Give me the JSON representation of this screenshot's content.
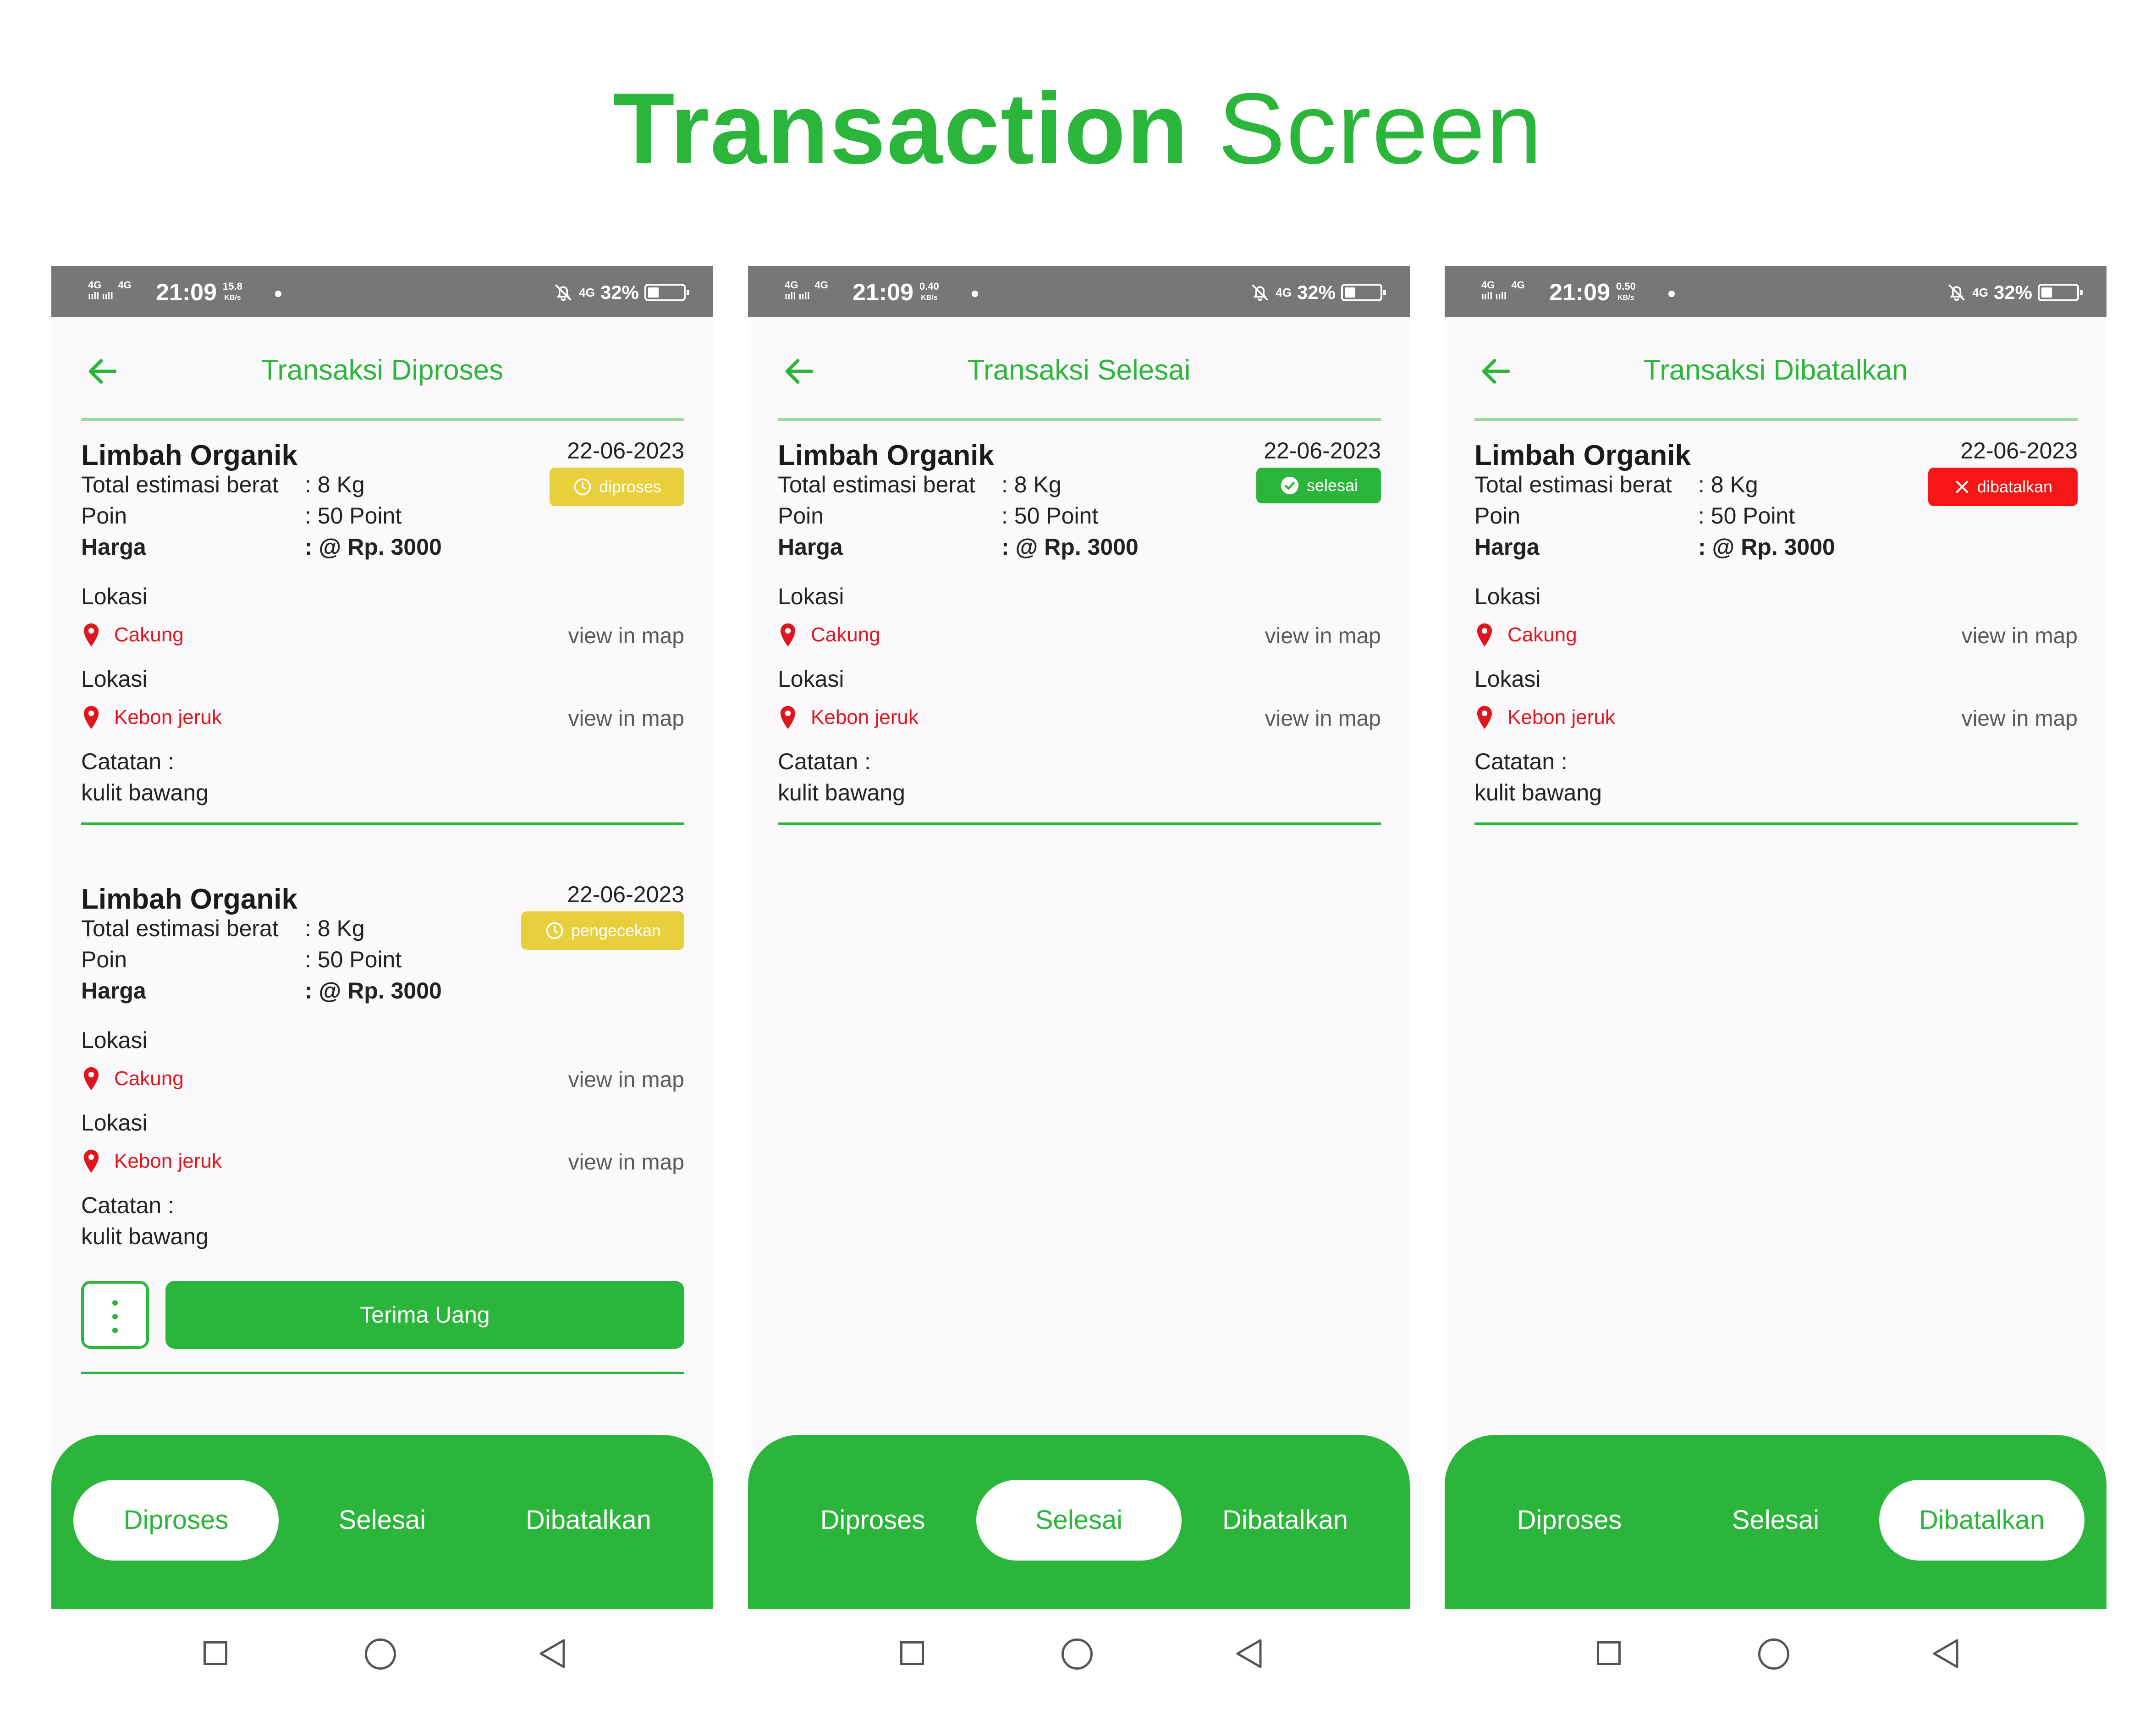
{
  "headline": {
    "bold": "Transaction",
    "light": "Screen"
  },
  "colors": {
    "brand_green": "#2bb53a",
    "badge_yellow": "#e8cf3c",
    "badge_red": "#f61616",
    "location_red": "#e0161e",
    "status_bar": "#777777"
  },
  "phones": [
    {
      "status": {
        "net1": "4G",
        "net2": "4G",
        "time": "21:09",
        "speed_value": "15.8",
        "speed_unit": "KB/s",
        "net3": "4G",
        "battery": "32%"
      },
      "title": "Transaksi Diproses",
      "cards": [
        {
          "name": "Limbah Organik",
          "date": "22-06-2023",
          "badge": "diproses",
          "weight_label": "Total estimasi berat",
          "weight_value": ": 8 Kg",
          "points_label": "Poin",
          "points_value": ": 50 Point",
          "price_label": "Harga",
          "price_value": ": @ Rp. 3000",
          "loc1_label": "Lokasi",
          "loc1_value": "Cakung",
          "loc1_link": "view in map",
          "loc2_label": "Lokasi",
          "loc2_value": "Kebon jeruk",
          "loc2_link": "view in map",
          "note_label": "Catatan :",
          "note_value": "kulit bawang"
        },
        {
          "name": "Limbah Organik",
          "date": "22-06-2023",
          "badge": "pengecekan",
          "weight_label": "Total estimasi berat",
          "weight_value": ": 8 Kg",
          "points_label": "Poin",
          "points_value": ": 50 Point",
          "price_label": "Harga",
          "price_value": ": @ Rp. 3000",
          "loc1_label": "Lokasi",
          "loc1_value": "Cakung",
          "loc1_link": "view in map",
          "loc2_label": "Lokasi",
          "loc2_value": "Kebon jeruk",
          "loc2_link": "view in map",
          "note_label": "Catatan :",
          "note_value": "kulit bawang",
          "action_label": "Terima Uang"
        }
      ],
      "tabs": [
        "Diproses",
        "Selesai",
        "Dibatalkan"
      ],
      "active_tab": "Diproses"
    },
    {
      "status": {
        "net1": "4G",
        "net2": "4G",
        "time": "21:09",
        "speed_value": "0.40",
        "speed_unit": "KB/s",
        "net3": "4G",
        "battery": "32%"
      },
      "title": "Transaksi Selesai",
      "cards": [
        {
          "name": "Limbah Organik",
          "date": "22-06-2023",
          "badge": "selesai",
          "weight_label": "Total estimasi berat",
          "weight_value": ": 8 Kg",
          "points_label": "Poin",
          "points_value": ": 50 Point",
          "price_label": "Harga",
          "price_value": ": @ Rp. 3000",
          "loc1_label": "Lokasi",
          "loc1_value": "Cakung",
          "loc1_link": "view in map",
          "loc2_label": "Lokasi",
          "loc2_value": "Kebon jeruk",
          "loc2_link": "view in map",
          "note_label": "Catatan :",
          "note_value": "kulit bawang"
        }
      ],
      "tabs": [
        "Diproses",
        "Selesai",
        "Dibatalkan"
      ],
      "active_tab": "Selesai"
    },
    {
      "status": {
        "net1": "4G",
        "net2": "4G",
        "time": "21:09",
        "speed_value": "0.50",
        "speed_unit": "KB/s",
        "net3": "4G",
        "battery": "32%"
      },
      "title": "Transaksi Dibatalkan",
      "cards": [
        {
          "name": "Limbah Organik",
          "date": "22-06-2023",
          "badge": "dibatalkan",
          "weight_label": "Total estimasi berat",
          "weight_value": ": 8 Kg",
          "points_label": "Poin",
          "points_value": ": 50 Point",
          "price_label": "Harga",
          "price_value": ": @ Rp. 3000",
          "loc1_label": "Lokasi",
          "loc1_value": "Cakung",
          "loc1_link": "view in map",
          "loc2_label": "Lokasi",
          "loc2_value": "Kebon jeruk",
          "loc2_link": "view in map",
          "note_label": "Catatan :",
          "note_value": "kulit bawang"
        }
      ],
      "tabs": [
        "Diproses",
        "Selesai",
        "Dibatalkan"
      ],
      "active_tab": "Dibatalkan"
    }
  ]
}
